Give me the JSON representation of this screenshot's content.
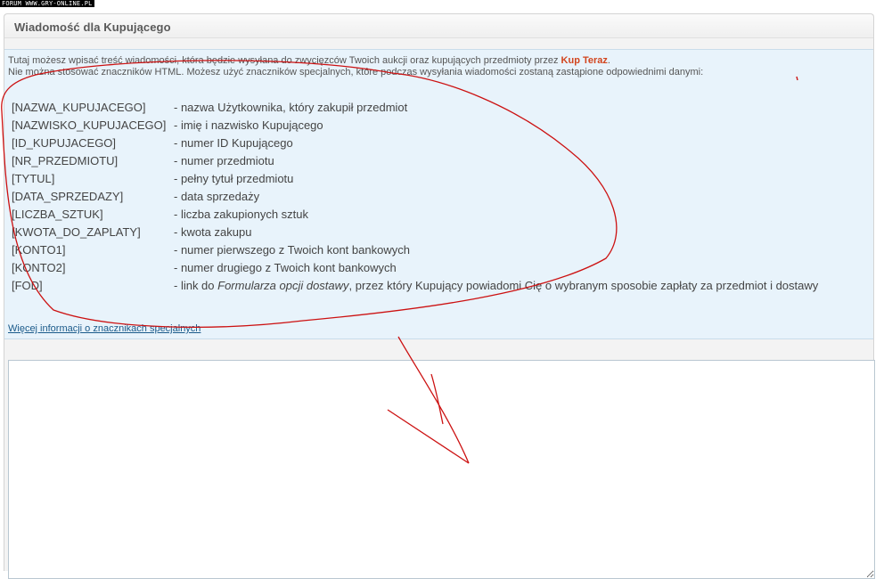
{
  "watermark": "FORUM WWW.GRY-ONLINE.PL",
  "panel": {
    "title": "Wiadomość dla Kupującego"
  },
  "intro": {
    "line1_prefix": "Tutaj możesz wpisać treść wiadomości, która będzie wysyłana do zwycięzców Twoich aukcji oraz kupujących przedmioty przez ",
    "brand": "Kup Teraz",
    "line1_suffix": ".",
    "line2": "Nie można stosować znaczników HTML. Możesz użyć znaczników specjalnych, które podczas wysyłania wiadomości zostaną zastąpione odpowiednimi danymi:"
  },
  "codes": [
    {
      "key": "[NAZWA_KUPUJACEGO]",
      "desc": "- nazwa Użytkownika, który zakupił przedmiot"
    },
    {
      "key": "[NAZWISKO_KUPUJACEGO]",
      "desc": "- imię i nazwisko Kupującego"
    },
    {
      "key": "[ID_KUPUJACEGO]",
      "desc": "- numer ID Kupującego"
    },
    {
      "key": "[NR_PRZEDMIOTU]",
      "desc": "- numer przedmiotu"
    },
    {
      "key": "[TYTUL]",
      "desc": "- pełny tytuł przedmiotu"
    },
    {
      "key": "[DATA_SPRZEDAZY]",
      "desc": "- data sprzedaży"
    },
    {
      "key": "[LICZBA_SZTUK]",
      "desc": "- liczba zakupionych sztuk"
    },
    {
      "key": "[KWOTA_DO_ZAPLATY]",
      "desc": "- kwota zakupu"
    },
    {
      "key": "[KONTO1]",
      "desc": "- numer pierwszego z Twoich kont bankowych"
    },
    {
      "key": "[KONTO2]",
      "desc": "- numer drugiego z Twoich kont bankowych"
    }
  ],
  "fod": {
    "key": "[FOD]",
    "desc_prefix": "- link do ",
    "desc_italic": "Formularza opcji dostawy",
    "desc_suffix": ", przez który Kupujący powiadomi Cię o wybranym sposobie zapłaty za przedmiot i dostawy"
  },
  "more_link": "Więcej informacji o znacznikach specjalnych",
  "editor": {
    "value": ""
  },
  "colors": {
    "brand": "#d2451e",
    "annotation": "#cc1111",
    "info_bg": "#e8f3fb"
  }
}
